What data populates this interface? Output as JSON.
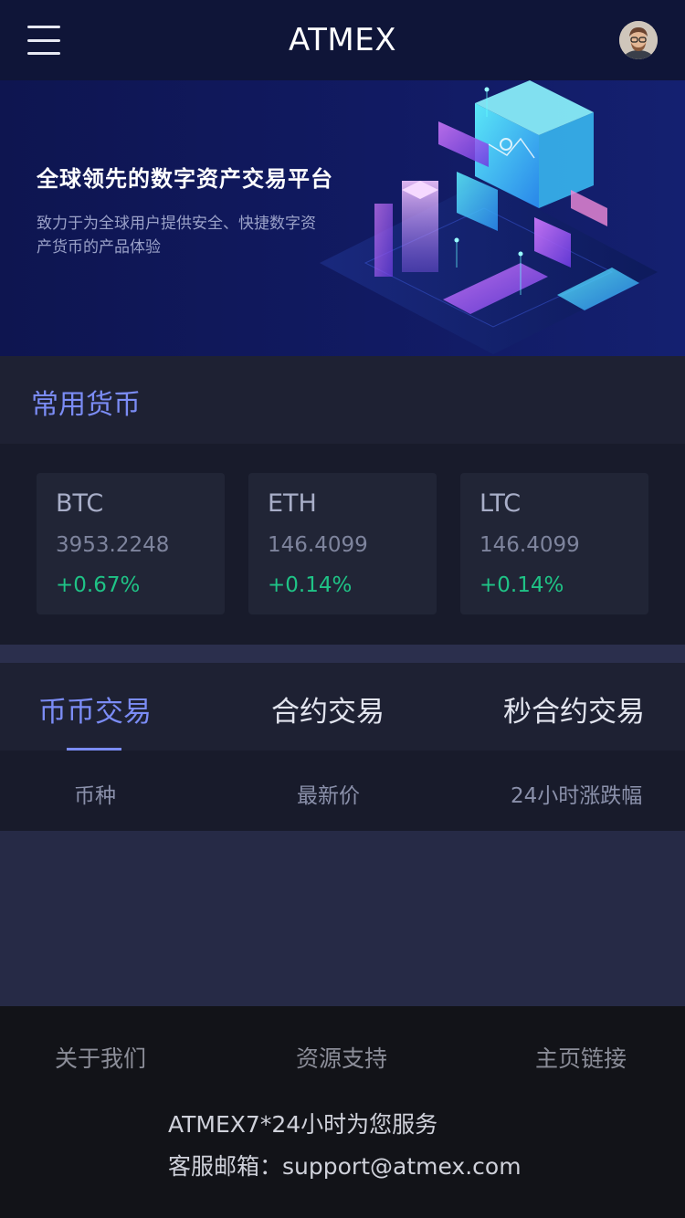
{
  "header": {
    "title": "ATMEX",
    "menu_icon": "hamburger-menu-icon",
    "avatar": "user-avatar"
  },
  "banner": {
    "title": "全球领先的数字资产交易平台",
    "description": "致力于为全球用户提供安全、快捷数字资产货币的产品体验"
  },
  "common_coins": {
    "title": "常用货币",
    "items": [
      {
        "symbol": "BTC",
        "price": "3953.2248",
        "change": "+0.67%"
      },
      {
        "symbol": "ETH",
        "price": "146.4099",
        "change": "+0.14%"
      },
      {
        "symbol": "LTC",
        "price": "146.4099",
        "change": "+0.14%"
      }
    ]
  },
  "trade_tabs": {
    "items": [
      {
        "label": "币币交易"
      },
      {
        "label": "合约交易"
      },
      {
        "label": "秒合约交易"
      }
    ],
    "active": 0
  },
  "table": {
    "columns": [
      "币种",
      "最新价",
      "24小时涨跌幅"
    ]
  },
  "footer": {
    "links": [
      "关于我们",
      "资源支持",
      "主页链接"
    ],
    "service": "ATMEX7*24小时为您服务",
    "email_label": "客服邮箱：",
    "email": "support@atmex.com"
  },
  "colors": {
    "accent": "#7b8cf5",
    "positive": "#1fc386",
    "header_bg": "#0f1538"
  }
}
